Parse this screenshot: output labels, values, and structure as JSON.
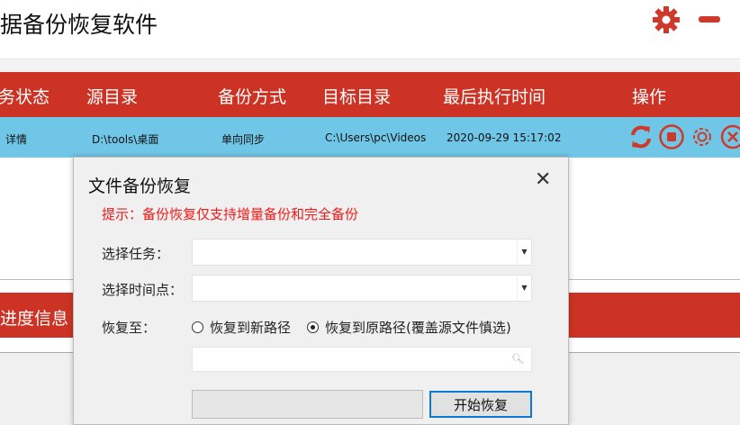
{
  "app": {
    "title": "据备份恢复软件",
    "settings_icon": "gear-icon",
    "minimize_icon": "minus-icon",
    "accent": "#cc3324"
  },
  "table": {
    "headers": [
      "务状态",
      "源目录",
      "备份方式",
      "目标目录",
      "最后执行时间",
      "操作"
    ],
    "rows": [
      {
        "status": "详情",
        "source": "D:\\tools\\桌面",
        "mode": "单向同步",
        "target": "C:\\Users\\pc\\Videos",
        "last_run": "2020-09-29 15:17:02"
      }
    ]
  },
  "progress_section": {
    "title": "进度信息"
  },
  "dialog": {
    "title": "文件备份恢复",
    "close": "✕",
    "hint": "提示：备份恢复仅支持增量备份和完全备份",
    "task_label": "选择任务：",
    "task_value": "",
    "time_label": "选择时间点：",
    "time_value": "",
    "restore_label": "恢复至：",
    "options": [
      "恢复到新路径",
      "恢复到原路径(覆盖源文件慎选)"
    ],
    "selected_option": 1,
    "path_value": "",
    "progress": 0,
    "start_button": "开始恢复"
  }
}
